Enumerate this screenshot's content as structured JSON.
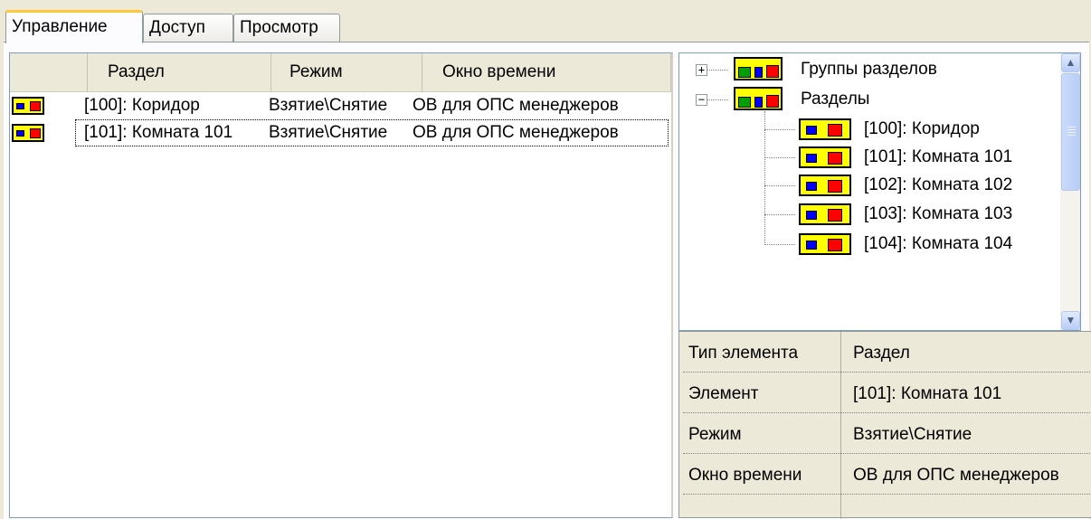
{
  "tabs": [
    {
      "label": "Управление",
      "active": true
    },
    {
      "label": "Доступ",
      "active": false
    },
    {
      "label": "Просмотр",
      "active": false
    }
  ],
  "list": {
    "columns": [
      "Раздел",
      "Режим",
      "Окно времени"
    ],
    "rows": [
      {
        "section": "[100]: Коридор",
        "mode": "Взятие\\Снятие",
        "window": "ОВ для ОПС менеджеров"
      },
      {
        "section": "[101]: Комната 101",
        "mode": "Взятие\\Снятие",
        "window": "ОВ для ОПС менеджеров"
      }
    ]
  },
  "tree": {
    "groups_label": "Группы разделов",
    "sections_label": "Разделы",
    "items": [
      "[100]: Коридор",
      "[101]: Комната 101",
      "[102]: Комната 102",
      "[103]: Комната 103",
      "[104]: Комната 104"
    ],
    "expand_symbol": "+",
    "collapse_symbol": "−"
  },
  "properties": [
    {
      "name": "Тип элемента",
      "value": "Раздел"
    },
    {
      "name": "Элемент",
      "value": "[101]: Комната 101"
    },
    {
      "name": "Режим",
      "value": "Взятие\\Снятие"
    },
    {
      "name": "Окно времени",
      "value": "ОВ для ОПС менеджеров"
    }
  ],
  "scroll": {
    "up_glyph": "▲",
    "down_glyph": "▼"
  }
}
